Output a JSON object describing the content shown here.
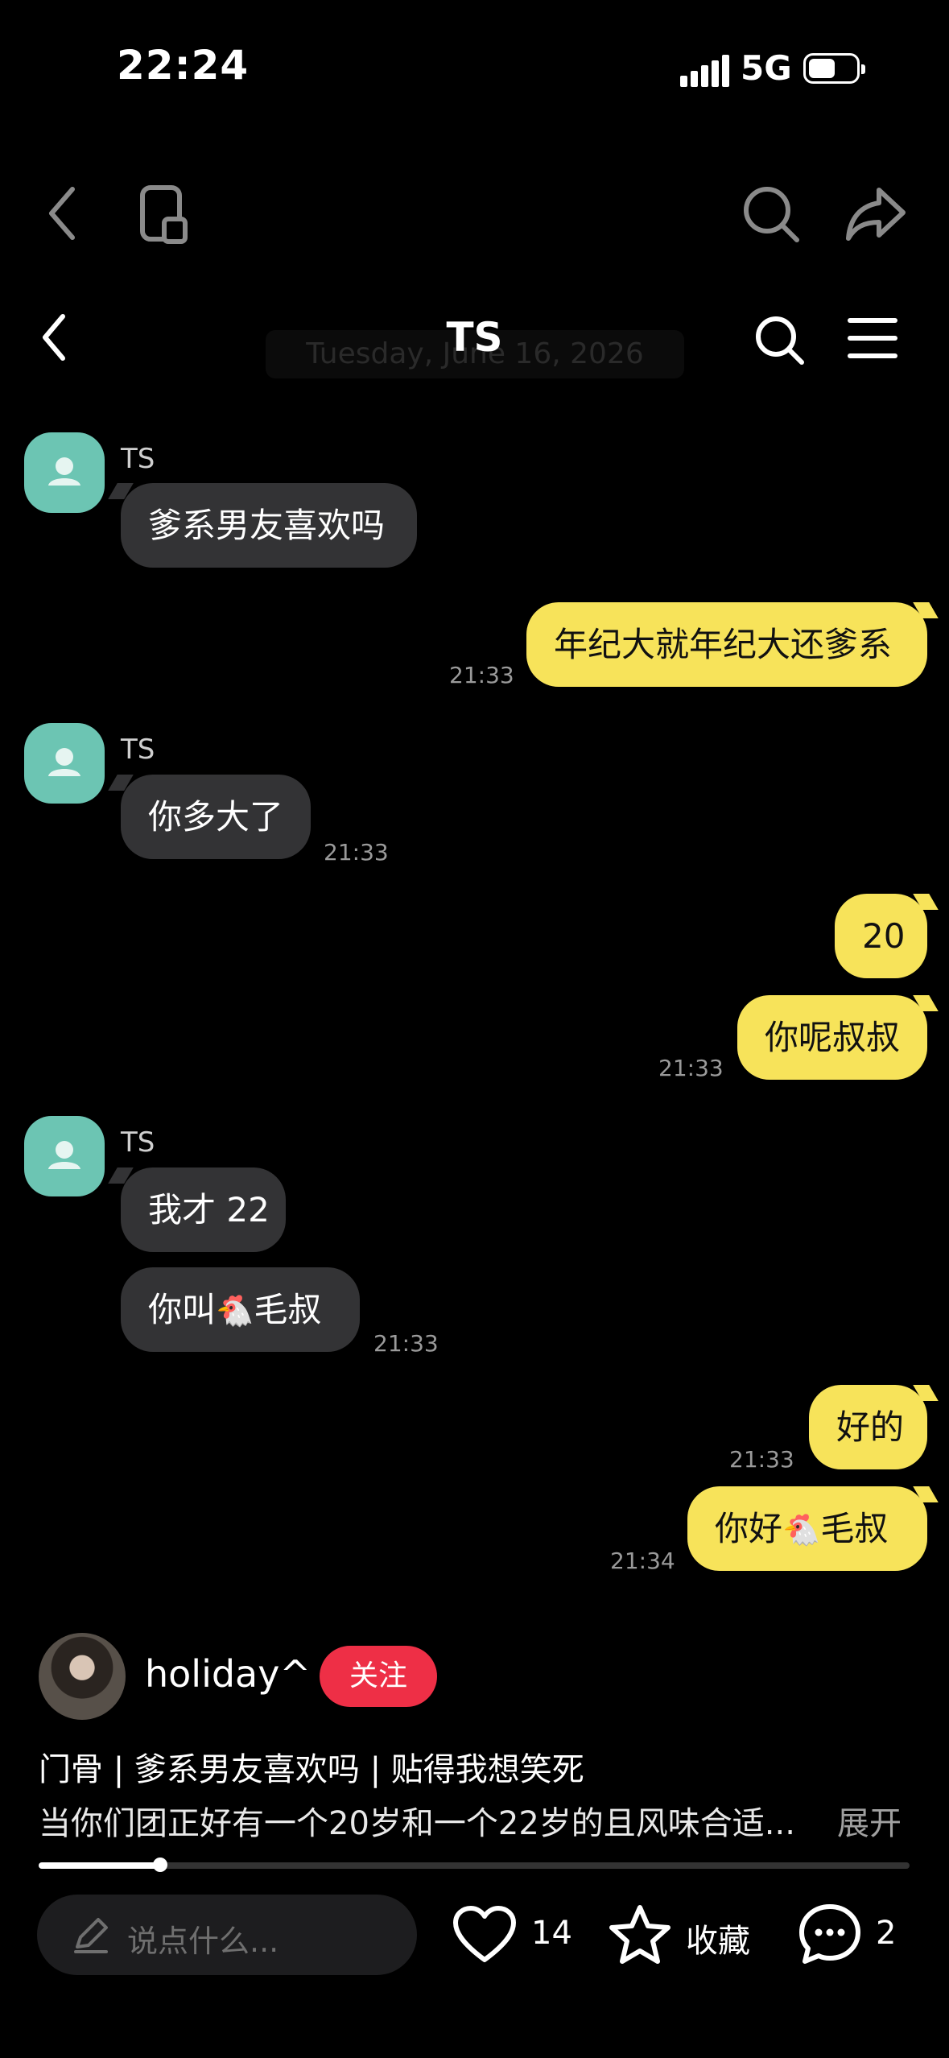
{
  "status_bar": {
    "time": "22:24",
    "network": "5G"
  },
  "nav_icons": [
    "back-icon",
    "mini-window-icon",
    "search-icon",
    "share-icon"
  ],
  "chat": {
    "title": "TS",
    "header_date": "Tuesday, June 16, 2026",
    "messages": [
      {
        "side": "left",
        "sender": "TS",
        "text": "爹系男友喜欢吗",
        "time": ""
      },
      {
        "side": "right",
        "text": "年纪大就年纪大还爹系",
        "time": "21:33"
      },
      {
        "side": "left",
        "sender": "TS",
        "text": "你多大了",
        "time": "21:33"
      },
      {
        "side": "right",
        "text": "20",
        "time": ""
      },
      {
        "side": "right",
        "text": "你呢叔叔",
        "time": "21:33"
      },
      {
        "side": "left",
        "sender": "TS",
        "text": "我才 22",
        "time": ""
      },
      {
        "side": "left",
        "text_before": "你叫",
        "text_after": "毛叔",
        "emoji": "🐔",
        "time": "21:33"
      },
      {
        "side": "right",
        "text": "好的",
        "time": "21:33"
      },
      {
        "side": "right",
        "text_before": "你好",
        "text_after": "毛叔",
        "emoji": "🐔",
        "time": "21:34"
      }
    ]
  },
  "post": {
    "author": "holiday^",
    "follow_label": "关注",
    "title": "门骨 | 爹系男友喜欢吗 | 贴得我想笑死",
    "body": "当你们团正好有一个20岁和一个22岁的且风味合适...",
    "expand_label": "展开",
    "progress": 0.14
  },
  "action_bar": {
    "comment_placeholder": "说点什么...",
    "likes": "14",
    "favorite_label": "收藏",
    "comments": "2"
  },
  "colors": {
    "incoming_bubble": "#333335",
    "outgoing_bubble": "#f7e35a",
    "follow_button": "#ee2f46",
    "avatar": "#6cc5b3"
  }
}
